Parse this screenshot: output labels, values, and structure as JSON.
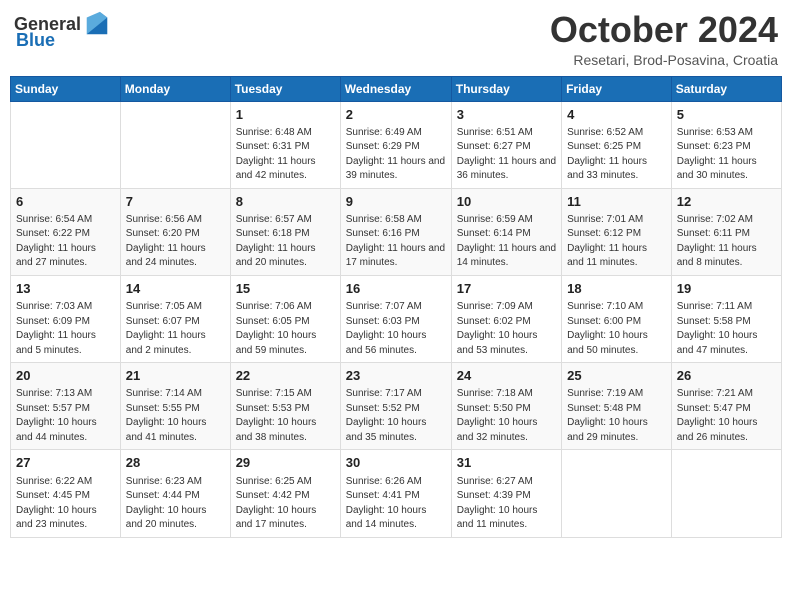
{
  "header": {
    "logo_general": "General",
    "logo_blue": "Blue",
    "title": "October 2024",
    "location": "Resetari, Brod-Posavina, Croatia"
  },
  "weekdays": [
    "Sunday",
    "Monday",
    "Tuesday",
    "Wednesday",
    "Thursday",
    "Friday",
    "Saturday"
  ],
  "weeks": [
    [
      {
        "day": "",
        "info": ""
      },
      {
        "day": "",
        "info": ""
      },
      {
        "day": "1",
        "info": "Sunrise: 6:48 AM\nSunset: 6:31 PM\nDaylight: 11 hours and 42 minutes."
      },
      {
        "day": "2",
        "info": "Sunrise: 6:49 AM\nSunset: 6:29 PM\nDaylight: 11 hours and 39 minutes."
      },
      {
        "day": "3",
        "info": "Sunrise: 6:51 AM\nSunset: 6:27 PM\nDaylight: 11 hours and 36 minutes."
      },
      {
        "day": "4",
        "info": "Sunrise: 6:52 AM\nSunset: 6:25 PM\nDaylight: 11 hours and 33 minutes."
      },
      {
        "day": "5",
        "info": "Sunrise: 6:53 AM\nSunset: 6:23 PM\nDaylight: 11 hours and 30 minutes."
      }
    ],
    [
      {
        "day": "6",
        "info": "Sunrise: 6:54 AM\nSunset: 6:22 PM\nDaylight: 11 hours and 27 minutes."
      },
      {
        "day": "7",
        "info": "Sunrise: 6:56 AM\nSunset: 6:20 PM\nDaylight: 11 hours and 24 minutes."
      },
      {
        "day": "8",
        "info": "Sunrise: 6:57 AM\nSunset: 6:18 PM\nDaylight: 11 hours and 20 minutes."
      },
      {
        "day": "9",
        "info": "Sunrise: 6:58 AM\nSunset: 6:16 PM\nDaylight: 11 hours and 17 minutes."
      },
      {
        "day": "10",
        "info": "Sunrise: 6:59 AM\nSunset: 6:14 PM\nDaylight: 11 hours and 14 minutes."
      },
      {
        "day": "11",
        "info": "Sunrise: 7:01 AM\nSunset: 6:12 PM\nDaylight: 11 hours and 11 minutes."
      },
      {
        "day": "12",
        "info": "Sunrise: 7:02 AM\nSunset: 6:11 PM\nDaylight: 11 hours and 8 minutes."
      }
    ],
    [
      {
        "day": "13",
        "info": "Sunrise: 7:03 AM\nSunset: 6:09 PM\nDaylight: 11 hours and 5 minutes."
      },
      {
        "day": "14",
        "info": "Sunrise: 7:05 AM\nSunset: 6:07 PM\nDaylight: 11 hours and 2 minutes."
      },
      {
        "day": "15",
        "info": "Sunrise: 7:06 AM\nSunset: 6:05 PM\nDaylight: 10 hours and 59 minutes."
      },
      {
        "day": "16",
        "info": "Sunrise: 7:07 AM\nSunset: 6:03 PM\nDaylight: 10 hours and 56 minutes."
      },
      {
        "day": "17",
        "info": "Sunrise: 7:09 AM\nSunset: 6:02 PM\nDaylight: 10 hours and 53 minutes."
      },
      {
        "day": "18",
        "info": "Sunrise: 7:10 AM\nSunset: 6:00 PM\nDaylight: 10 hours and 50 minutes."
      },
      {
        "day": "19",
        "info": "Sunrise: 7:11 AM\nSunset: 5:58 PM\nDaylight: 10 hours and 47 minutes."
      }
    ],
    [
      {
        "day": "20",
        "info": "Sunrise: 7:13 AM\nSunset: 5:57 PM\nDaylight: 10 hours and 44 minutes."
      },
      {
        "day": "21",
        "info": "Sunrise: 7:14 AM\nSunset: 5:55 PM\nDaylight: 10 hours and 41 minutes."
      },
      {
        "day": "22",
        "info": "Sunrise: 7:15 AM\nSunset: 5:53 PM\nDaylight: 10 hours and 38 minutes."
      },
      {
        "day": "23",
        "info": "Sunrise: 7:17 AM\nSunset: 5:52 PM\nDaylight: 10 hours and 35 minutes."
      },
      {
        "day": "24",
        "info": "Sunrise: 7:18 AM\nSunset: 5:50 PM\nDaylight: 10 hours and 32 minutes."
      },
      {
        "day": "25",
        "info": "Sunrise: 7:19 AM\nSunset: 5:48 PM\nDaylight: 10 hours and 29 minutes."
      },
      {
        "day": "26",
        "info": "Sunrise: 7:21 AM\nSunset: 5:47 PM\nDaylight: 10 hours and 26 minutes."
      }
    ],
    [
      {
        "day": "27",
        "info": "Sunrise: 6:22 AM\nSunset: 4:45 PM\nDaylight: 10 hours and 23 minutes."
      },
      {
        "day": "28",
        "info": "Sunrise: 6:23 AM\nSunset: 4:44 PM\nDaylight: 10 hours and 20 minutes."
      },
      {
        "day": "29",
        "info": "Sunrise: 6:25 AM\nSunset: 4:42 PM\nDaylight: 10 hours and 17 minutes."
      },
      {
        "day": "30",
        "info": "Sunrise: 6:26 AM\nSunset: 4:41 PM\nDaylight: 10 hours and 14 minutes."
      },
      {
        "day": "31",
        "info": "Sunrise: 6:27 AM\nSunset: 4:39 PM\nDaylight: 10 hours and 11 minutes."
      },
      {
        "day": "",
        "info": ""
      },
      {
        "day": "",
        "info": ""
      }
    ]
  ]
}
